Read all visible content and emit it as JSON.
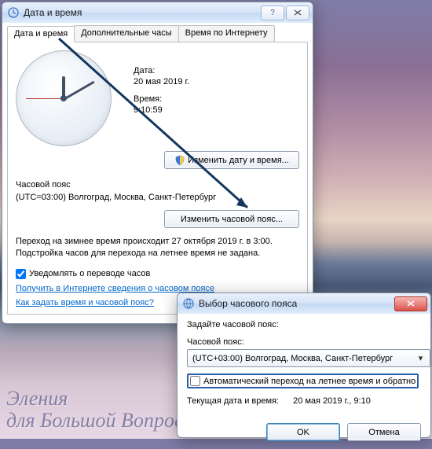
{
  "win1": {
    "title": "Дата и время",
    "tabs": [
      "Дата и время",
      "Дополнительные часы",
      "Время по Интернету"
    ],
    "date_label": "Дата:",
    "date_value": "20 мая 2019 г.",
    "time_label": "Время:",
    "time_value": "9:10:59",
    "btn_change_dt": "Изменить дату и время...",
    "tz_label": "Часовой пояс",
    "tz_value": "(UTC=03:00) Волгоград, Москва, Санкт-Петербург",
    "btn_change_tz": "Изменить часовой пояс...",
    "dst_info1": "Переход на зимнее время происходит 27 октября 2019 г. в 3:00.",
    "dst_info2": "Подстройка часов для перехода на летнее время не задана.",
    "chk_notify": "Уведомлять о переводе часов",
    "link1": "Получить в Интернете сведения о часовом поясе",
    "link2": "Как задать время и часовой пояс?"
  },
  "win2": {
    "title": "Выбор часового пояса",
    "intro": "Задайте часовой пояс:",
    "tz_label": "Часовой пояс:",
    "tz_value": "(UTC+03:00) Волгоград, Москва, Санкт-Петербург",
    "chk_dst": "Автоматический переход на летнее время и обратно",
    "current_label": "Текущая дата и время:",
    "current_value": "20 мая 2019 г., 9:10",
    "ok": "OK",
    "cancel": "Отмена"
  },
  "watermark": {
    "l1": "Эления",
    "l2": "для Большой Вопрос"
  }
}
